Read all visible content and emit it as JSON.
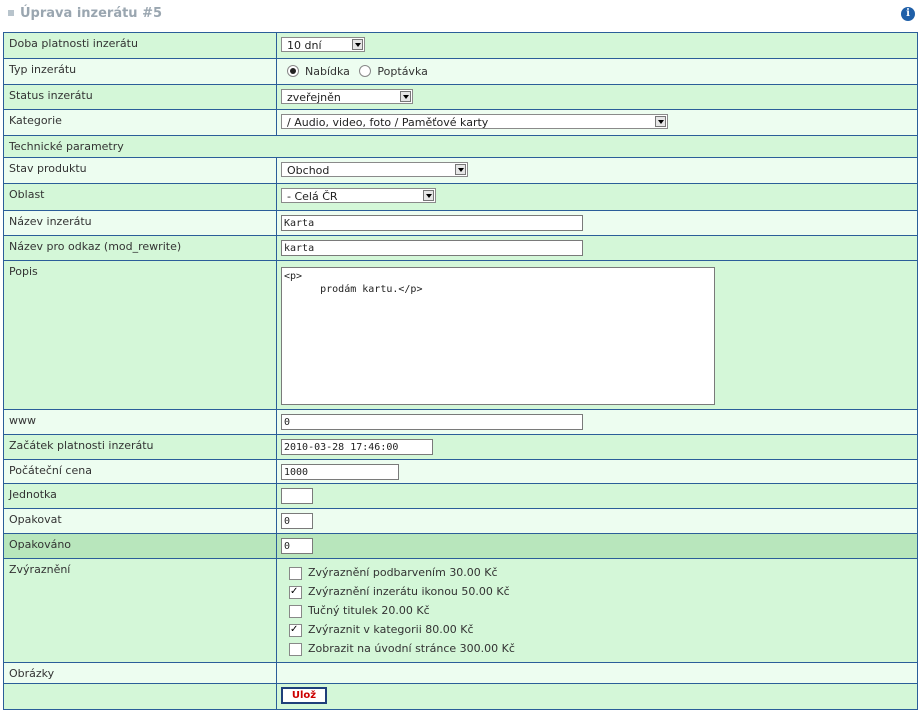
{
  "page": {
    "title": "Úprava inzerátu #5"
  },
  "fields": {
    "doba_platnosti": {
      "label": "Doba platnosti inzerátu",
      "value": "10 dní"
    },
    "typ": {
      "label": "Typ inzerátu",
      "options": [
        "Nabídka",
        "Poptávka"
      ],
      "selected": "Nabídka"
    },
    "status": {
      "label": "Status inzerátu",
      "value": "zveřejněn"
    },
    "kategorie": {
      "label": "Kategorie",
      "value": "/ Audio, video, foto / Paměťové karty"
    },
    "technicke": {
      "label": "Technické parametry"
    },
    "stav": {
      "label": "Stav produktu",
      "value": "Obchod"
    },
    "oblast": {
      "label": "Oblast",
      "value": "- Celá ČR"
    },
    "nazev": {
      "label": "Název inzerátu",
      "value": "Karta"
    },
    "odkaz": {
      "label": "Název pro odkaz (mod_rewrite)",
      "value": "karta"
    },
    "popis": {
      "label": "Popis",
      "value": "<p>\n      prodám kartu.</p>"
    },
    "www": {
      "label": "www",
      "value": "0"
    },
    "zacatek": {
      "label": "Začátek platnosti inzerátu",
      "value": "2010-03-28 17:46:00"
    },
    "cena": {
      "label": "Počáteční cena",
      "value": "1000"
    },
    "jednotka": {
      "label": "Jednotka",
      "value": ""
    },
    "opakovat": {
      "label": "Opakovat",
      "value": "0"
    },
    "opakovano": {
      "label": "Opakováno",
      "value": "0"
    },
    "zvyrazneni": {
      "label": "Zvýraznění",
      "options": [
        {
          "label": "Zvýraznění podbarvením 30.00 Kč",
          "checked": false
        },
        {
          "label": "Zvýraznění inzerátu ikonou 50.00 Kč",
          "checked": true
        },
        {
          "label": "Tučný titulek 20.00 Kč",
          "checked": false
        },
        {
          "label": "Zvýraznit v kategorii 80.00 Kč",
          "checked": true
        },
        {
          "label": "Zobrazit na úvodní stránce 300.00 Kč",
          "checked": false
        }
      ]
    },
    "obrazky": {
      "label": "Obrázky"
    }
  },
  "submit": {
    "label": "Ulož"
  }
}
